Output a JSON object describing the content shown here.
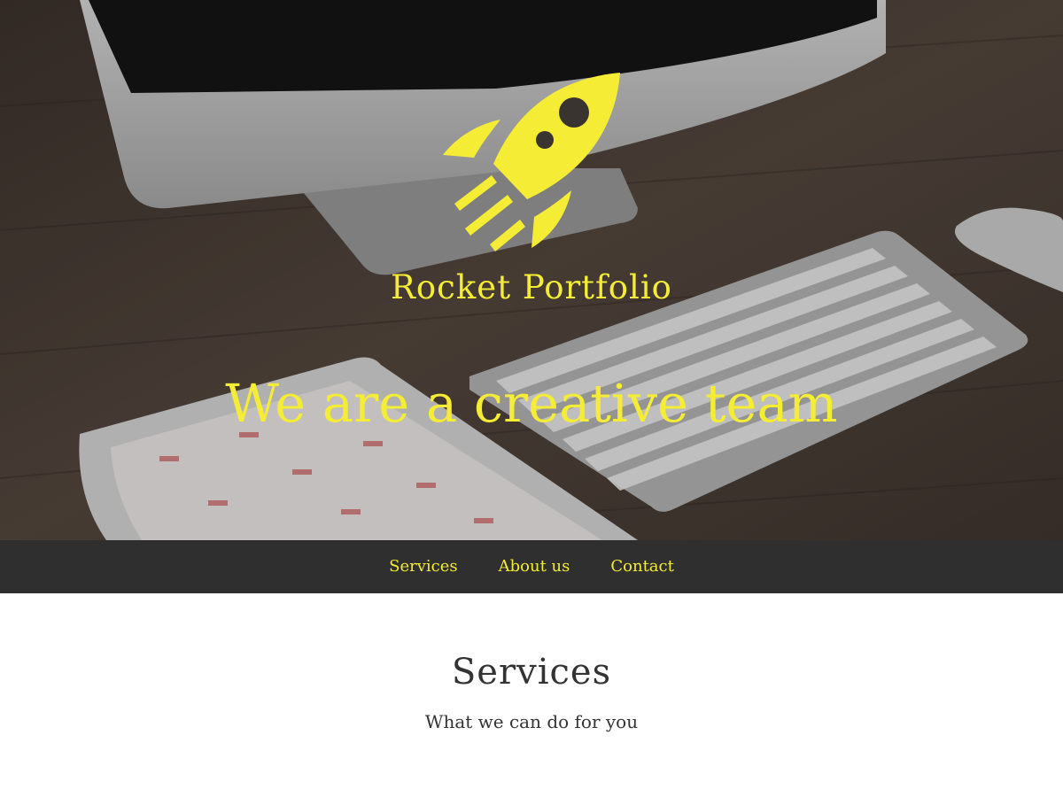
{
  "colors": {
    "accent": "#f5ec35",
    "nav_background": "#2f2f2f",
    "text_dark": "#333333"
  },
  "hero": {
    "logo_icon": "rocket-icon",
    "site_title": "Rocket Portfolio",
    "tagline": "We are a creative team"
  },
  "nav": {
    "items": [
      {
        "label": "Services"
      },
      {
        "label": "About us"
      },
      {
        "label": "Contact"
      }
    ]
  },
  "services": {
    "title": "Services",
    "subtitle": "What we can do for you"
  }
}
